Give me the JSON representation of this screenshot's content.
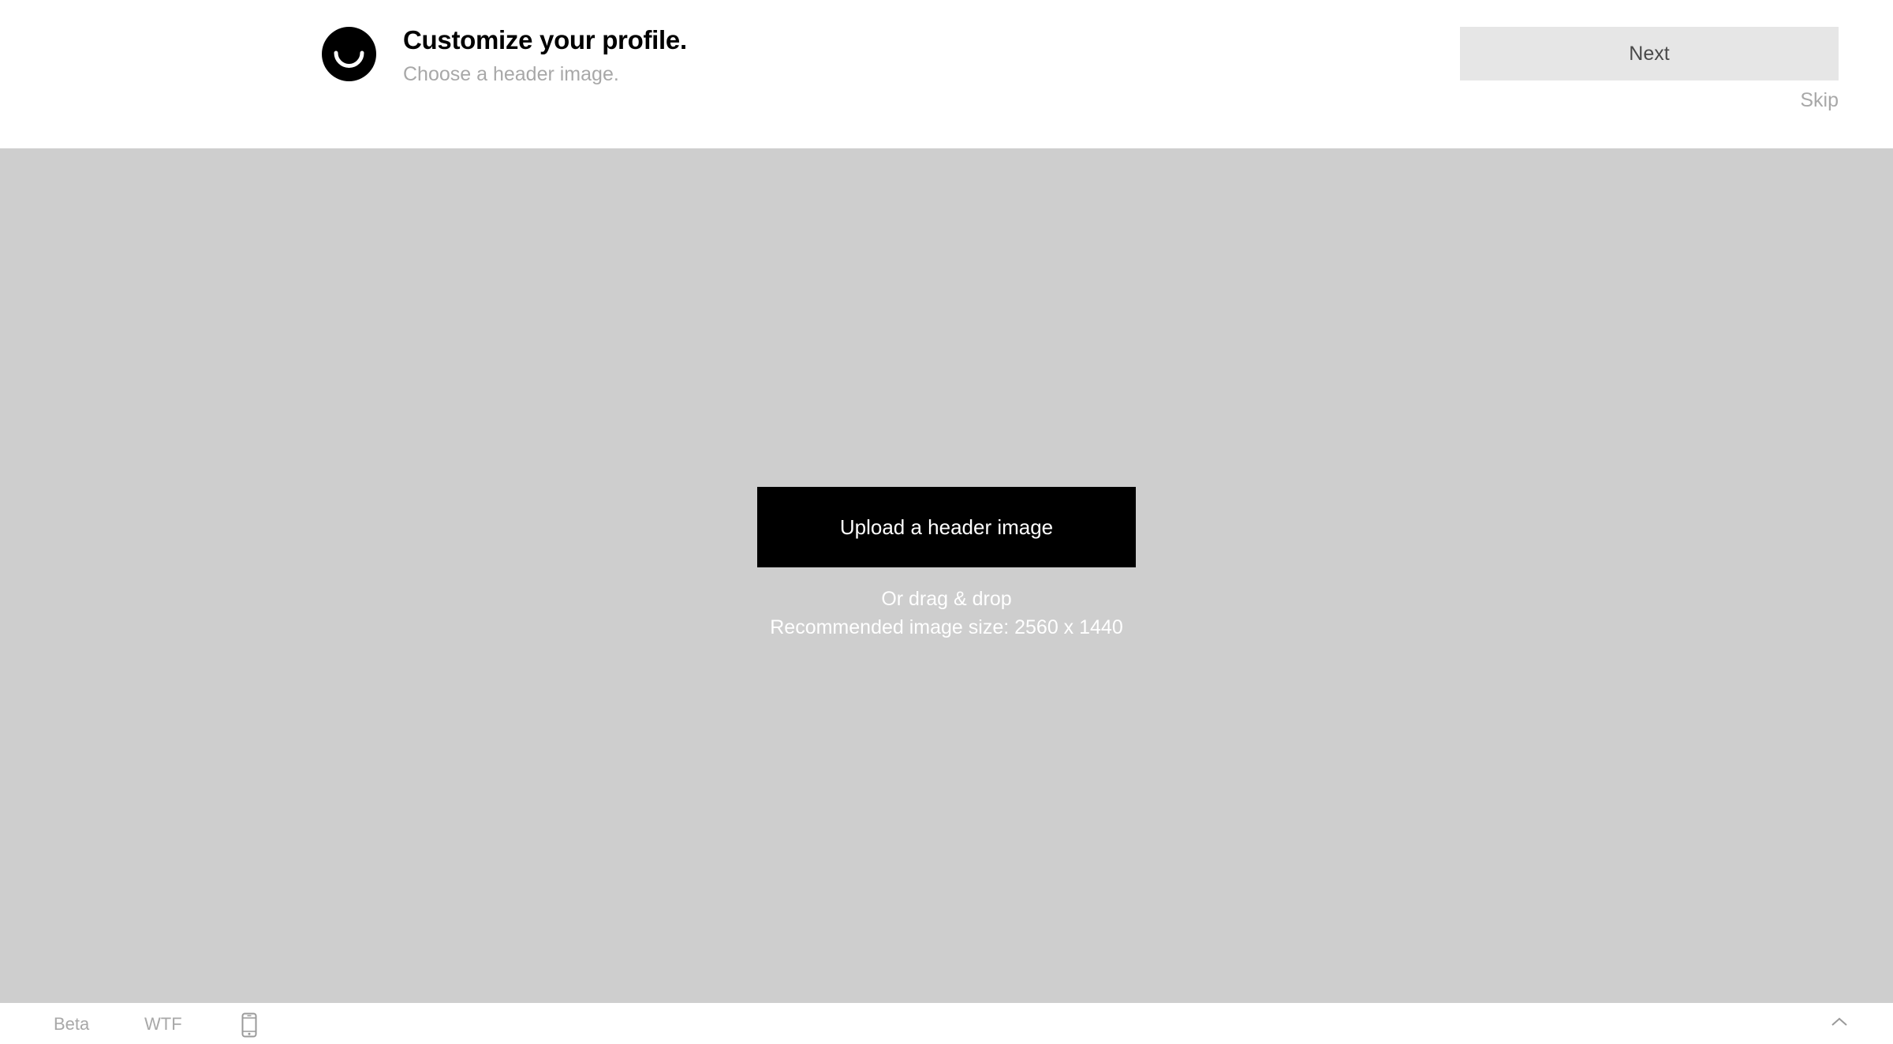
{
  "header": {
    "title": "Customize your profile.",
    "subtitle": "Choose a header image.",
    "logo_icon": "ello-smile-logo-icon",
    "next_label": "Next",
    "skip_label": "Skip"
  },
  "dropzone": {
    "upload_label": "Upload a header image",
    "drag_hint": "Or drag & drop",
    "size_hint": "Recommended image size: 2560 x 1440",
    "background_color": "#cecece"
  },
  "footer": {
    "links": [
      {
        "label": "Beta"
      },
      {
        "label": "WTF"
      }
    ],
    "phone_icon": "phone-icon",
    "scroll_top_icon": "chevron-up-icon"
  },
  "colors": {
    "accent": "#000000",
    "muted_text": "#a8a8a8",
    "next_button_bg": "#e6e6e6"
  }
}
